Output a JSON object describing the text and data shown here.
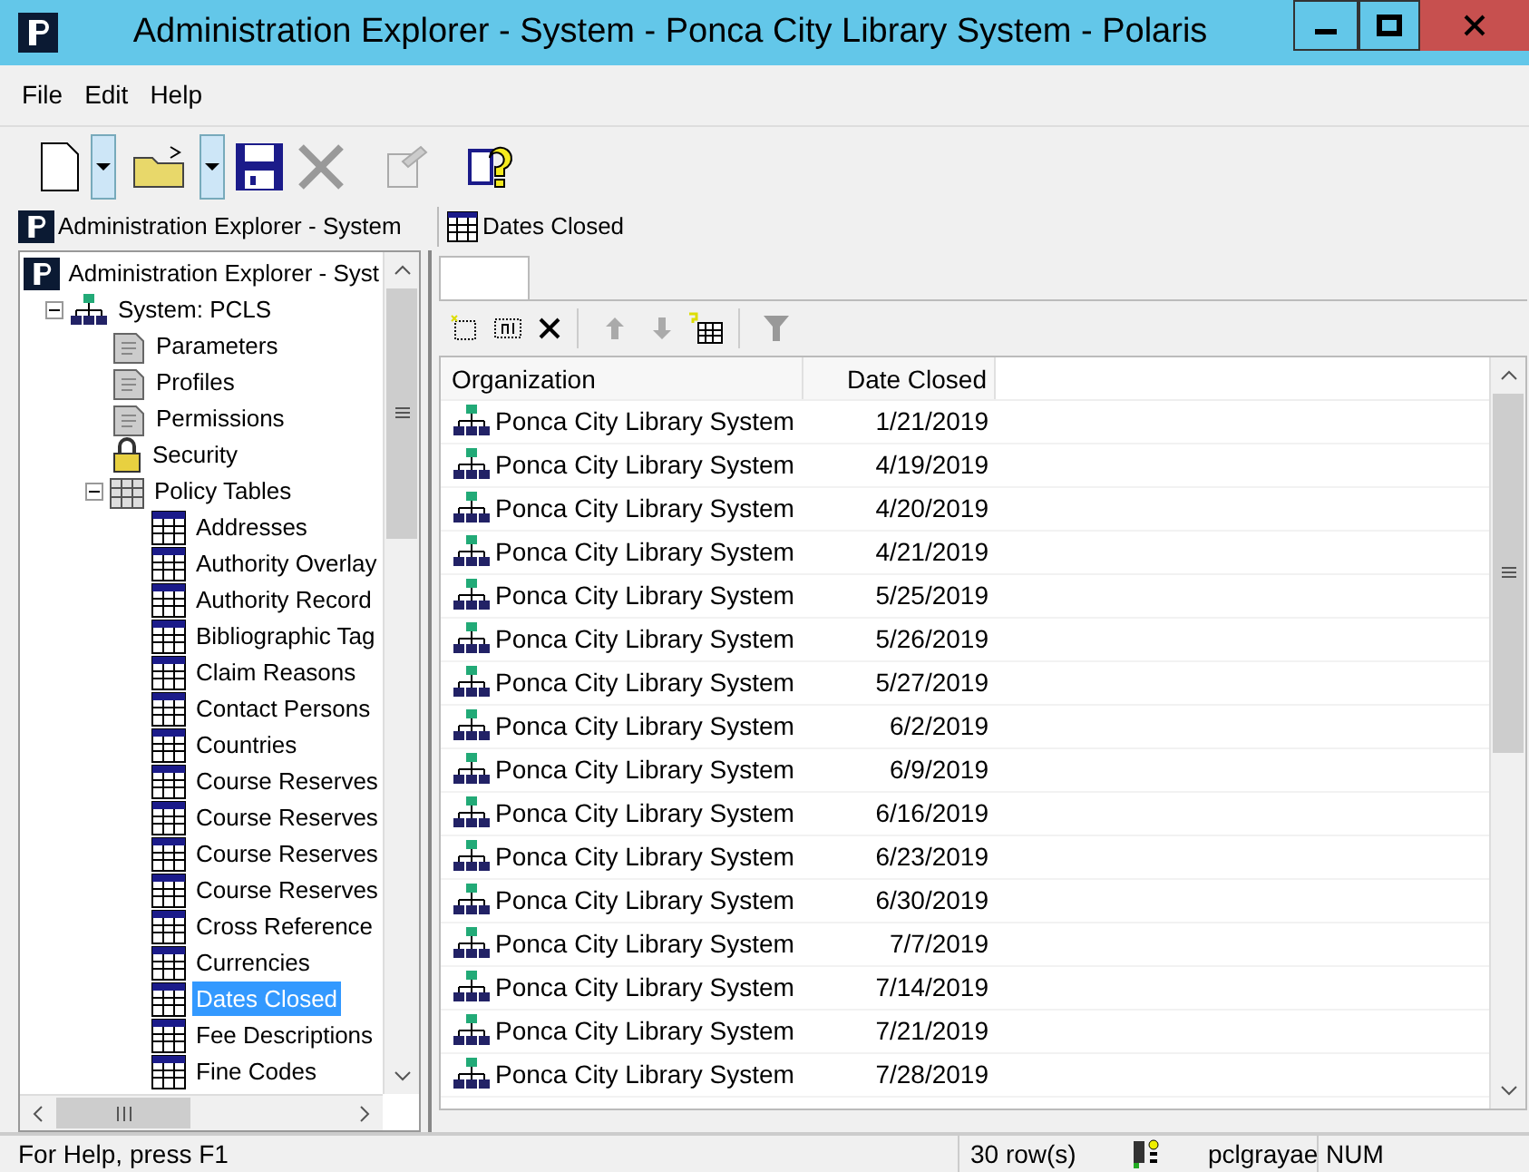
{
  "window": {
    "title": "Administration Explorer - System - Ponca City Library System - Polaris"
  },
  "menu": [
    "File",
    "Edit",
    "Help"
  ],
  "left_pane": {
    "title": "Administration Explorer - System"
  },
  "tree": [
    {
      "label": "Administration Explorer - Syst",
      "kind": "logo",
      "selected": false,
      "children": [
        {
          "label": "System: PCLS",
          "kind": "network",
          "expanded": true,
          "selected": false,
          "children": [
            {
              "label": "Parameters",
              "kind": "document",
              "selected": false
            },
            {
              "label": "Profiles",
              "kind": "document",
              "selected": false
            },
            {
              "label": "Permissions",
              "kind": "document",
              "selected": false
            },
            {
              "label": "Security",
              "kind": "lock",
              "selected": false
            },
            {
              "label": "Policy Tables",
              "kind": "tables",
              "expanded": true,
              "selected": false,
              "children": [
                {
                  "label": "Addresses",
                  "kind": "table",
                  "selected": false
                },
                {
                  "label": "Authority Overlay",
                  "kind": "table",
                  "selected": false
                },
                {
                  "label": "Authority Record",
                  "kind": "table",
                  "selected": false
                },
                {
                  "label": "Bibliographic Tag",
                  "kind": "table",
                  "selected": false
                },
                {
                  "label": "Claim Reasons",
                  "kind": "table",
                  "selected": false
                },
                {
                  "label": "Contact Persons",
                  "kind": "table",
                  "selected": false
                },
                {
                  "label": "Countries",
                  "kind": "table",
                  "selected": false
                },
                {
                  "label": "Course Reserves",
                  "kind": "table",
                  "selected": false
                },
                {
                  "label": "Course Reserves",
                  "kind": "table",
                  "selected": false
                },
                {
                  "label": "Course Reserves",
                  "kind": "table",
                  "selected": false
                },
                {
                  "label": "Course Reserves",
                  "kind": "table",
                  "selected": false
                },
                {
                  "label": "Cross Reference",
                  "kind": "table",
                  "selected": false
                },
                {
                  "label": "Currencies",
                  "kind": "table",
                  "selected": false
                },
                {
                  "label": "Dates Closed",
                  "kind": "table",
                  "selected": true
                },
                {
                  "label": "Fee Descriptions",
                  "kind": "table",
                  "selected": false
                },
                {
                  "label": "Fine Codes",
                  "kind": "table",
                  "selected": false
                }
              ]
            }
          ]
        }
      ]
    }
  ],
  "right_pane": {
    "title": "Dates Closed"
  },
  "table": {
    "columns": [
      "Organization",
      "Date Closed"
    ],
    "rows": [
      [
        "Ponca City Library System",
        "1/21/2019"
      ],
      [
        "Ponca City Library System",
        "4/19/2019"
      ],
      [
        "Ponca City Library System",
        "4/20/2019"
      ],
      [
        "Ponca City Library System",
        "4/21/2019"
      ],
      [
        "Ponca City Library System",
        "5/25/2019"
      ],
      [
        "Ponca City Library System",
        "5/26/2019"
      ],
      [
        "Ponca City Library System",
        "5/27/2019"
      ],
      [
        "Ponca City Library System",
        "6/2/2019"
      ],
      [
        "Ponca City Library System",
        "6/9/2019"
      ],
      [
        "Ponca City Library System",
        "6/16/2019"
      ],
      [
        "Ponca City Library System",
        "6/23/2019"
      ],
      [
        "Ponca City Library System",
        "6/30/2019"
      ],
      [
        "Ponca City Library System",
        "7/7/2019"
      ],
      [
        "Ponca City Library System",
        "7/14/2019"
      ],
      [
        "Ponca City Library System",
        "7/21/2019"
      ],
      [
        "Ponca City Library System",
        "7/28/2019"
      ]
    ]
  },
  "status_bar": {
    "help": "For Help, press F1",
    "rows": "30 row(s)",
    "user": "pclgrayae",
    "num": "NUM"
  }
}
